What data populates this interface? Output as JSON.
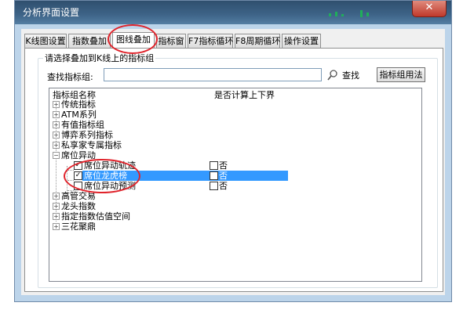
{
  "window": {
    "title": "分析界面设置",
    "close_symbol": "✕"
  },
  "tabs": [
    {
      "label": "K线图设置"
    },
    {
      "label": "指数叠加"
    },
    {
      "label": "图线叠加",
      "active": true
    },
    {
      "label": "指标窗"
    },
    {
      "label": "F7指标循环"
    },
    {
      "label": "F8周期循环"
    },
    {
      "label": "操作设置"
    }
  ],
  "group": {
    "title": "请选择叠加到K线上的指标组"
  },
  "search": {
    "label": "查找指标组:",
    "value": "",
    "find_label": "查找",
    "method_label": "指标组用法"
  },
  "list": {
    "headers": {
      "name": "指标组名称",
      "calc": "是否计算上下界"
    },
    "items": [
      {
        "label": "传统指标",
        "expander": "+"
      },
      {
        "label": "ATM系列",
        "expander": "+"
      },
      {
        "label": "有值指标组",
        "expander": "+"
      },
      {
        "label": "博弈系列指标",
        "expander": "+"
      },
      {
        "label": "私享家专属指标",
        "expander": "+"
      },
      {
        "label": "席位异动",
        "expander": "−"
      },
      {
        "label": "席位异动轨迹",
        "checked": true,
        "child": true,
        "calc": "否"
      },
      {
        "label": "席位龙虎榜",
        "checked": true,
        "child": true,
        "calc": "否",
        "selected": true
      },
      {
        "label": "席位异动预测",
        "checked": false,
        "child": true,
        "calc": "否"
      },
      {
        "label": "高管交易",
        "expander": "+"
      },
      {
        "label": "龙头指数",
        "expander": "+"
      },
      {
        "label": "指定指数估值空间",
        "expander": "+"
      },
      {
        "label": "三花聚鼎",
        "expander": "+"
      }
    ]
  },
  "colors": {
    "selection": "#3399ff",
    "highlight_circle": "#e0232b",
    "title_bar": "#3e6488"
  }
}
